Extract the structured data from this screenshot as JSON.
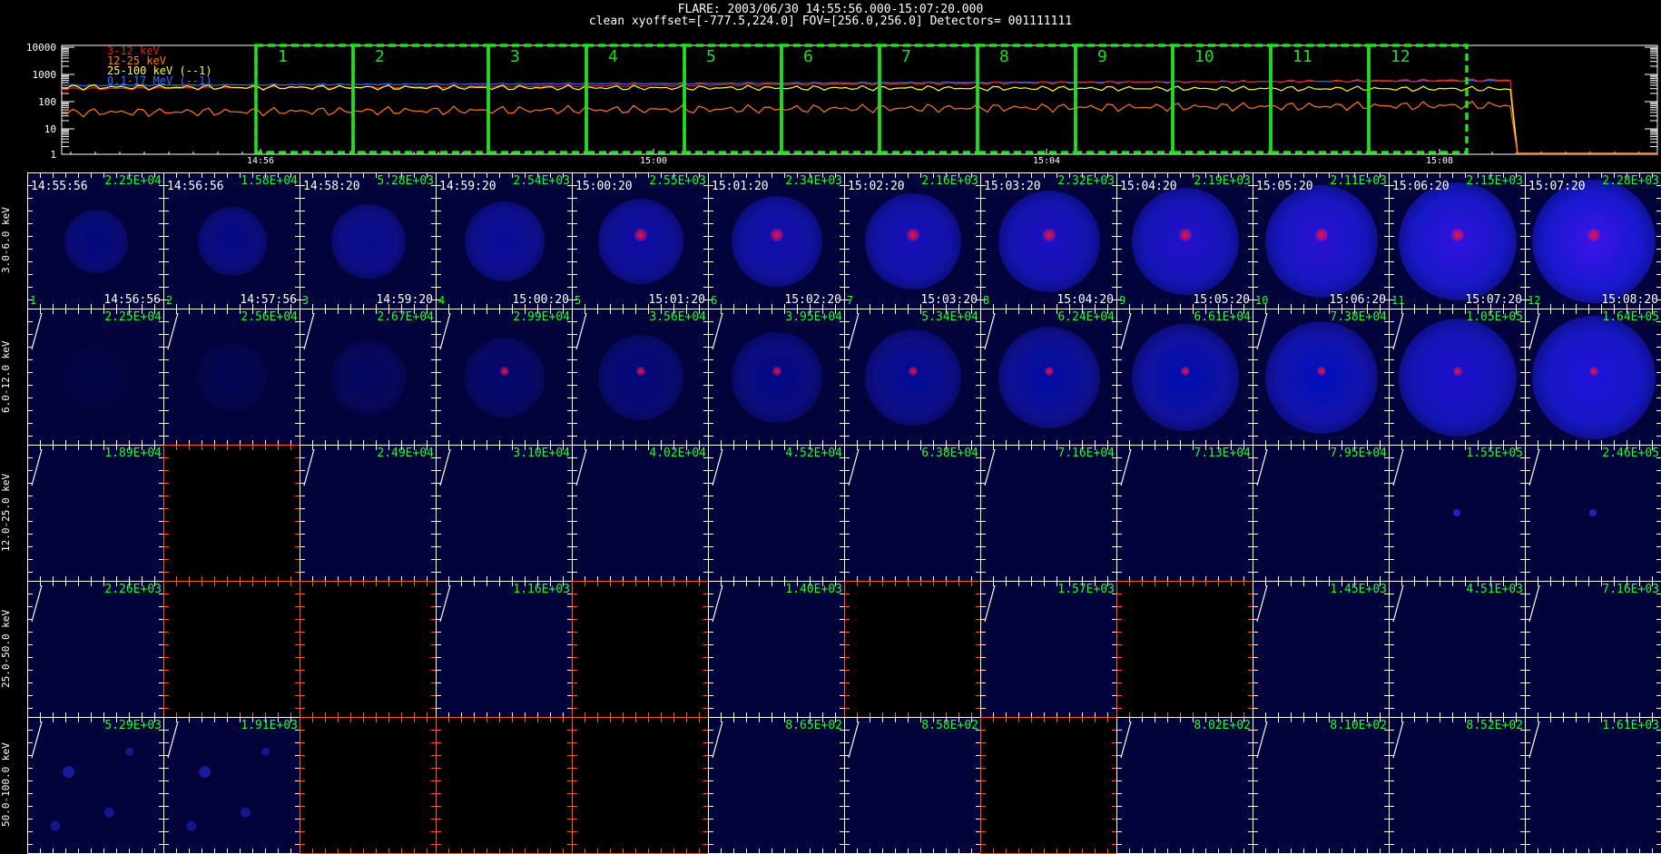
{
  "header": {
    "line1": "FLARE: 2003/06/30 14:55:56.000-15:07:20.000",
    "line2": "clean   xyoffset=[-777.5,224.0]   FOV=[256.0,256.0]   Detectors= 001111111"
  },
  "lightcurve": {
    "y_ticks": [
      "10000",
      "1000",
      "100",
      "10",
      "1"
    ],
    "x_ticks": [
      "14:56",
      "15:00",
      "15:04",
      "15:08"
    ],
    "legend": [
      {
        "label": "3-12 keV",
        "color": "#e0201a"
      },
      {
        "label": "12-25 keV",
        "color": "#ff7a1a"
      },
      {
        "label": "25-100 keV (--1)",
        "color": "#ffff33"
      },
      {
        "label": "0.1-17 MeV (--1)",
        "color": "#3070ff"
      }
    ],
    "intervals": [
      "1",
      "2",
      "3",
      "4",
      "5",
      "6",
      "7",
      "8",
      "9",
      "10",
      "11",
      "12"
    ],
    "interval_color": "#22dd22"
  },
  "rows": [
    {
      "label": "3.0-6.0 keV",
      "counts": [
        "2.25E+04",
        "1.58E+04",
        "5.28E+03",
        "2.54E+03",
        "2.55E+03",
        "2.34E+03",
        "2.16E+03",
        "2.32E+03",
        "2.19E+03",
        "2.11E+03",
        "2.15E+03",
        "2.28E+03"
      ]
    },
    {
      "label": "6.0-12.0 keV",
      "counts": [
        "2.25E+04",
        "2.56E+04",
        "2.67E+04",
        "2.99E+04",
        "3.56E+04",
        "3.95E+04",
        "5.34E+04",
        "6.24E+04",
        "6.61E+04",
        "7.38E+04",
        "1.05E+05",
        "1.64E+05"
      ]
    },
    {
      "label": "12.0-25.0 keV",
      "counts": [
        "1.89E+04",
        "",
        "2.49E+04",
        "3.10E+04",
        "4.02E+04",
        "4.52E+04",
        "6.38E+04",
        "7.16E+04",
        "7.13E+04",
        "7.95E+04",
        "1.55E+05",
        "2.46E+05"
      ]
    },
    {
      "label": "25.0-50.0 keV",
      "counts": [
        "2.26E+03",
        "",
        "",
        "1.16E+03",
        "",
        "1.40E+03",
        "",
        "1.57E+03",
        "",
        "1.45E+03",
        "4.51E+03",
        "7.16E+03"
      ]
    },
    {
      "label": "50.0-100.0 keV",
      "counts": [
        "5.29E+03",
        "1.91E+03",
        "",
        "",
        "",
        "8.65E+02",
        "8.58E+02",
        "",
        "8.02E+02",
        "8.10E+02",
        "8.52E+02",
        "1.61E+03"
      ]
    }
  ],
  "time_starts": [
    "14:55:56",
    "14:56:56",
    "14:58:20",
    "14:59:20",
    "15:00:20",
    "15:01:20",
    "15:02:20",
    "15:03:20",
    "15:04:20",
    "15:05:20",
    "15:06:20",
    "15:07:20"
  ],
  "time_ends": [
    "14:56:56",
    "14:57:56",
    "14:59:20",
    "15:00:20",
    "15:01:20",
    "15:02:20",
    "15:03:20",
    "15:04:20",
    "15:05:20",
    "15:06:20",
    "15:07:20",
    "15:08:20"
  ],
  "empty_cells": {
    "2": [
      1
    ],
    "3": [
      1,
      2,
      4,
      6,
      8
    ],
    "4": [
      2,
      3,
      4,
      7
    ]
  },
  "colors": {
    "count_text": "#22ff22",
    "empty_border": "#ff5a1f",
    "image_bg": "#02033a"
  }
}
